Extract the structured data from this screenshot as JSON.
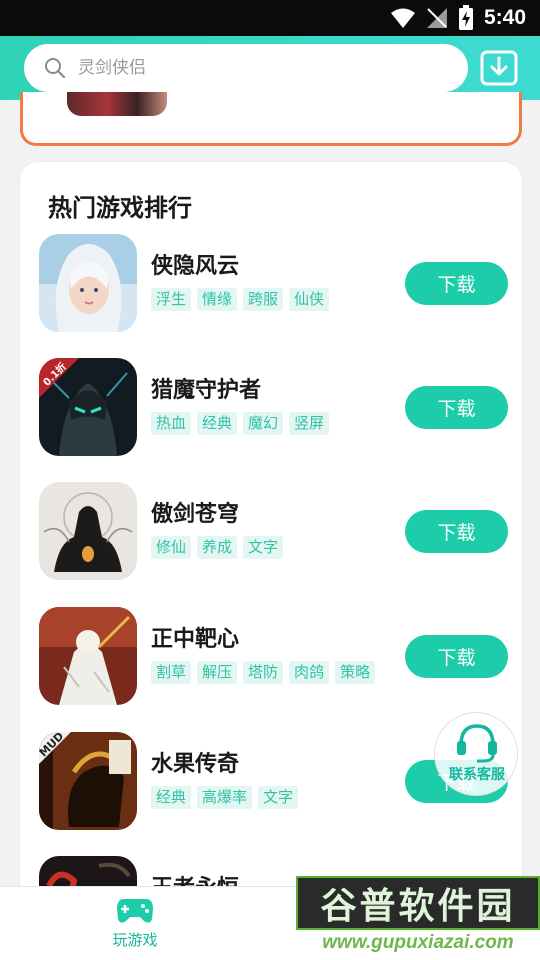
{
  "status_bar": {
    "time": "5:40"
  },
  "search": {
    "placeholder": "灵剑侠侣"
  },
  "section": {
    "title": "热门游戏排行"
  },
  "games": [
    {
      "name": "侠隐风云",
      "tags": [
        "浮生",
        "情缘",
        "跨服",
        "仙侠"
      ],
      "button": "下载"
    },
    {
      "name": "猎魔守护者",
      "tags": [
        "热血",
        "经典",
        "魔幻",
        "竖屏"
      ],
      "button": "下载",
      "badge": "0.1折"
    },
    {
      "name": "傲剑苍穹",
      "tags": [
        "修仙",
        "养成",
        "文字"
      ],
      "button": "下载"
    },
    {
      "name": "正中靶心",
      "tags": [
        "割草",
        "解压",
        "塔防",
        "肉鸽",
        "策略"
      ],
      "button": "下载"
    },
    {
      "name": "水果传奇",
      "tags": [
        "经典",
        "高爆率",
        "文字"
      ],
      "button": "下载",
      "badge": "MUD"
    },
    {
      "name": "王者永恒"
    }
  ],
  "customer_service": {
    "label": "联系客服"
  },
  "bottom_nav": {
    "items": [
      {
        "label": "玩游戏",
        "icon": "gamepad-icon"
      }
    ]
  },
  "watermark": {
    "title": "谷普软件园",
    "url": "www.gupuxiazai.com"
  },
  "colors": {
    "accent": "#1dcca8",
    "tag_bg": "#e3f6f2",
    "tag_text": "#31c2a7",
    "banner_border": "#f27b44"
  }
}
